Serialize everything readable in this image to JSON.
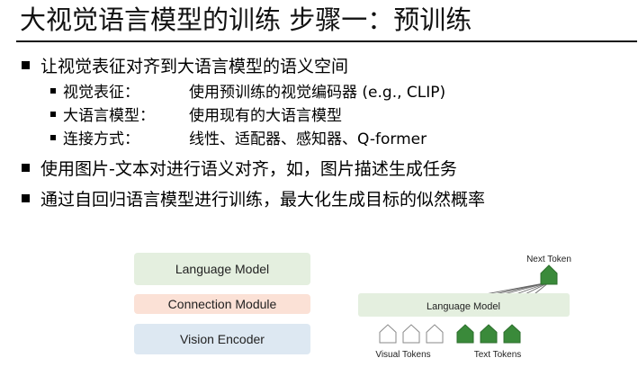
{
  "slide": {
    "title": "大视觉语言模型的训练   步骤一：预训练"
  },
  "bullets": [
    {
      "text": "让视觉表征对齐到大语言模型的语义空间",
      "sub": [
        {
          "term": "视觉表征：",
          "desc": "使用预训练的视觉编码器 (e.g., CLIP)"
        },
        {
          "term": "大语言模型：",
          "desc": "使用现有的大语言模型"
        },
        {
          "term": "连接方式：",
          "desc": "线性、适配器、感知器、Q-former"
        }
      ]
    },
    {
      "text": "使用图片-文本对进行语义对齐，如，图片描述生成任务"
    },
    {
      "text": "通过自回归语言模型进行训练，最大化生成目标的似然概率"
    }
  ],
  "stack_diagram": {
    "language_model": "Language Model",
    "connection_module": "Connection Module",
    "vision_encoder": "Vision Encoder"
  },
  "token_diagram": {
    "next_token": "Next Token",
    "language_model": "Language Model",
    "visual_tokens": "Visual Tokens",
    "text_tokens": "Text Tokens",
    "visual_token_count": 3,
    "text_token_count": 3,
    "colors": {
      "language_model_bar": "#e4efdf",
      "visual_token_fill": "#ffffff",
      "text_token_fill": "#3a8a3a",
      "next_token_fill": "#3a8a3a"
    }
  },
  "colors": {
    "language_model_box": "#e4efdf",
    "connection_module_box": "#fbe1d6",
    "vision_encoder_box": "#dde8f2"
  }
}
